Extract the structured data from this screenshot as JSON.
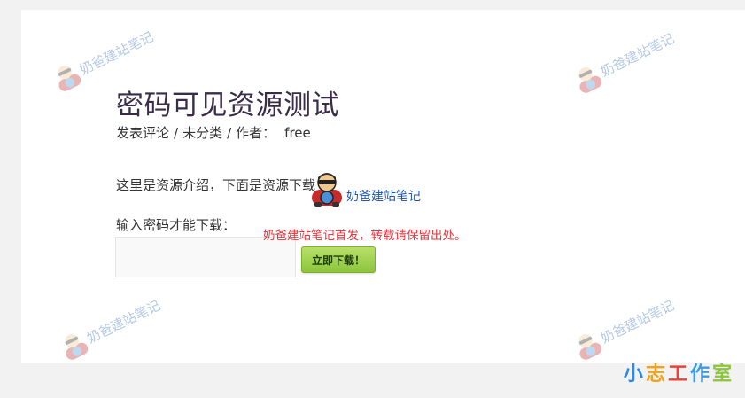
{
  "post": {
    "title": "密码可见资源测试",
    "meta": {
      "category_prefix": "发表评论",
      "category": "未分类",
      "author_label": "作者：",
      "author": "free"
    },
    "intro": "这里是资源介绍，下面是资源下载",
    "password_label": "输入密码才能下载：",
    "password_value": "",
    "download_button": "立即下载！"
  },
  "overlay": {
    "badge_text": "奶爸建站笔记",
    "notice": "奶爸建站笔记首发，转载请保留出处。",
    "watermark_text": "奶爸建站笔记",
    "studio_chars": [
      "小",
      "志",
      "工",
      "作",
      "室"
    ],
    "studio_colors": [
      "#2a8de0",
      "#f0a21b",
      "#e8433a",
      "#3d9ae0",
      "#8cc43c"
    ]
  },
  "colors": {
    "title": "#3a2b4a",
    "notice": "#e8343c",
    "badge_link": "#1e55b3",
    "button_green": "#8cc43c",
    "page_bg": "#f2f2f2"
  },
  "icons": [
    "cartoon-mascot-icon",
    "watermark-mascot-icon"
  ]
}
